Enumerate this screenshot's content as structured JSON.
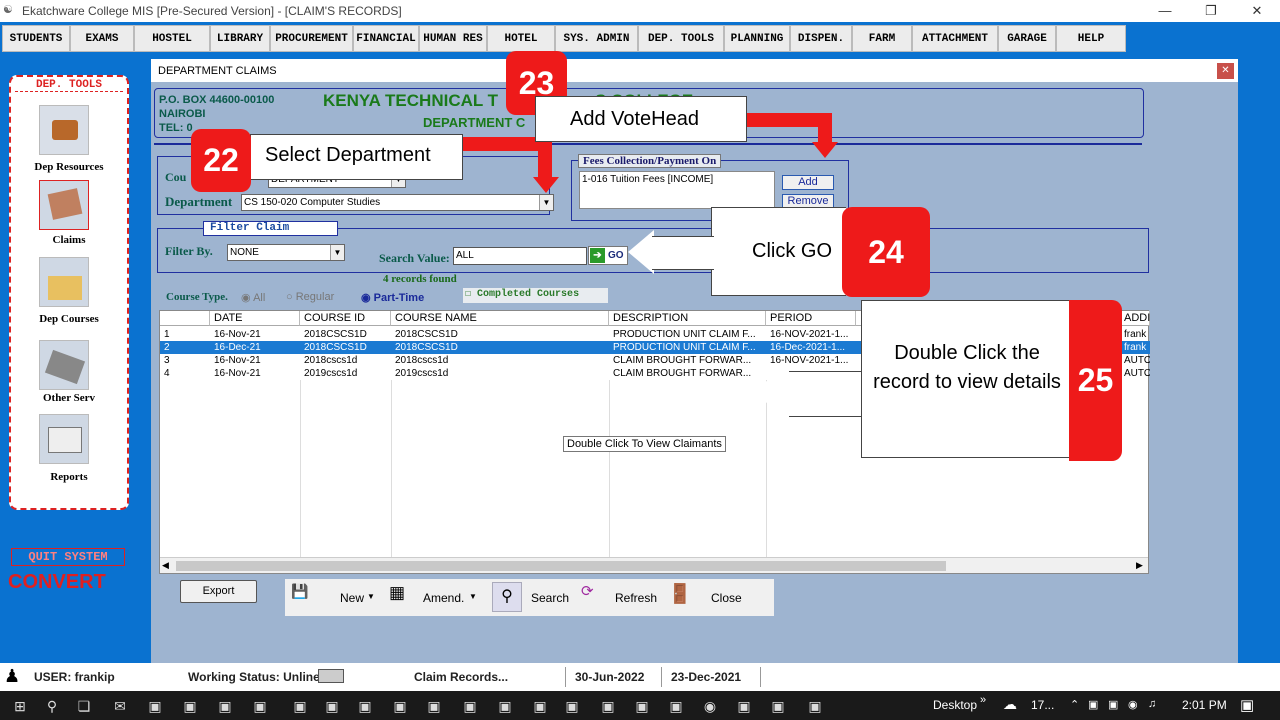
{
  "window": {
    "title": "Ekatchware College MIS [Pre-Secured Version] - [CLAIM'S RECORDS]"
  },
  "menu": [
    "STUDENTS",
    "EXAMS",
    "HOSTEL",
    "LIBRARY",
    "PROCUREMENT",
    "FINANCIAL",
    "HUMAN RES",
    "HOTEL",
    "SYS. ADMIN",
    "DEP. TOOLS",
    "PLANNING",
    "DISPEN.",
    "FARM",
    "ATTACHMENT",
    "GARAGE",
    "HELP"
  ],
  "sidebar": {
    "header": "DEP. TOOLS",
    "items": [
      {
        "label": "Dep Resources"
      },
      {
        "label": "Claims"
      },
      {
        "label": "Dep Courses"
      },
      {
        "label": "Other Serv"
      },
      {
        "label": "Reports"
      }
    ],
    "quit": "QUIT SYSTEM",
    "convert": "CONVERT"
  },
  "dialog": {
    "title": "DEPARTMENT CLAIMS",
    "address1": "P.O. BOX 44600-00100",
    "address2": "NAIROBI",
    "address3": "TEL: 0",
    "college": "KENYA TECHNICAL T",
    "college_tail": "S COLLEGE",
    "subtitle": "DEPARTMENT C",
    "course_label": "Cou",
    "course_value": "DEPARTMENT",
    "dept_label": "Department",
    "dept_value": "CS 150-020 Computer Studies",
    "fees_title": "Fees Collection/Payment On",
    "fees_item": "1-016 Tuition Fees [INCOME]",
    "add": "Add",
    "remove": "Remove",
    "filter_title": "Filter Claim",
    "filter_by_label": "Filter By.",
    "filter_by_value": "NONE",
    "search_label": "Search Value:",
    "search_value": "ALL",
    "go": "GO",
    "records": "4 records found",
    "course_type_label": "Course Type.",
    "opt_all": "All",
    "opt_regular": "Regular",
    "opt_part": "Part-Time",
    "completed": "Completed Courses",
    "tooltip": "Double Click To View Claimants"
  },
  "grid": {
    "headers": [
      "DATE",
      "COURSE ID",
      "COURSE NAME",
      "DESCRIPTION",
      "PERIOD",
      "ADDI"
    ],
    "rows": [
      {
        "n": "1",
        "date": "16-Nov-21",
        "cid": "2018CSCS1D",
        "cname": "2018CSCS1D",
        "desc": "PRODUCTION UNIT CLAIM F...",
        "period": "16-NOV-2021-1...",
        "addi": "frank"
      },
      {
        "n": "2",
        "date": "16-Dec-21",
        "cid": "2018CSCS1D",
        "cname": "2018CSCS1D",
        "desc": "PRODUCTION UNIT CLAIM F...",
        "period": "16-Dec-2021-1...",
        "addi": "frank"
      },
      {
        "n": "3",
        "date": "16-Nov-21",
        "cid": "2018cscs1d",
        "cname": "2018cscs1d",
        "desc": "CLAIM BROUGHT FORWAR...",
        "period": "16-NOV-2021-1...",
        "addi": "AUTO"
      },
      {
        "n": "4",
        "date": "16-Nov-21",
        "cid": "2019cscs1d",
        "cname": "2019cscs1d",
        "desc": "CLAIM BROUGHT FORWAR...",
        "period": "",
        "addi": "AUTO"
      }
    ]
  },
  "toolbar": {
    "export": "Export",
    "new": "New",
    "amend": "Amend.",
    "search": "Search",
    "refresh": "Refresh",
    "close": "Close"
  },
  "callouts": {
    "c22_num": "22",
    "c22_text": "Select Department",
    "c23_num": "23",
    "c23_text": "Add VoteHead",
    "c24_num": "24",
    "c24_text": "Click GO",
    "c25_num": "25",
    "c25_text": "Double Click the record to view details"
  },
  "status": {
    "user": "USER: frankip",
    "working": "Working Status: Unline",
    "module": "Claim Records...",
    "date1": "30-Jun-2022",
    "date2": "23-Dec-2021"
  },
  "taskbar": {
    "desktop": "Desktop",
    "weather": "17...",
    "time": "2:01 PM"
  }
}
